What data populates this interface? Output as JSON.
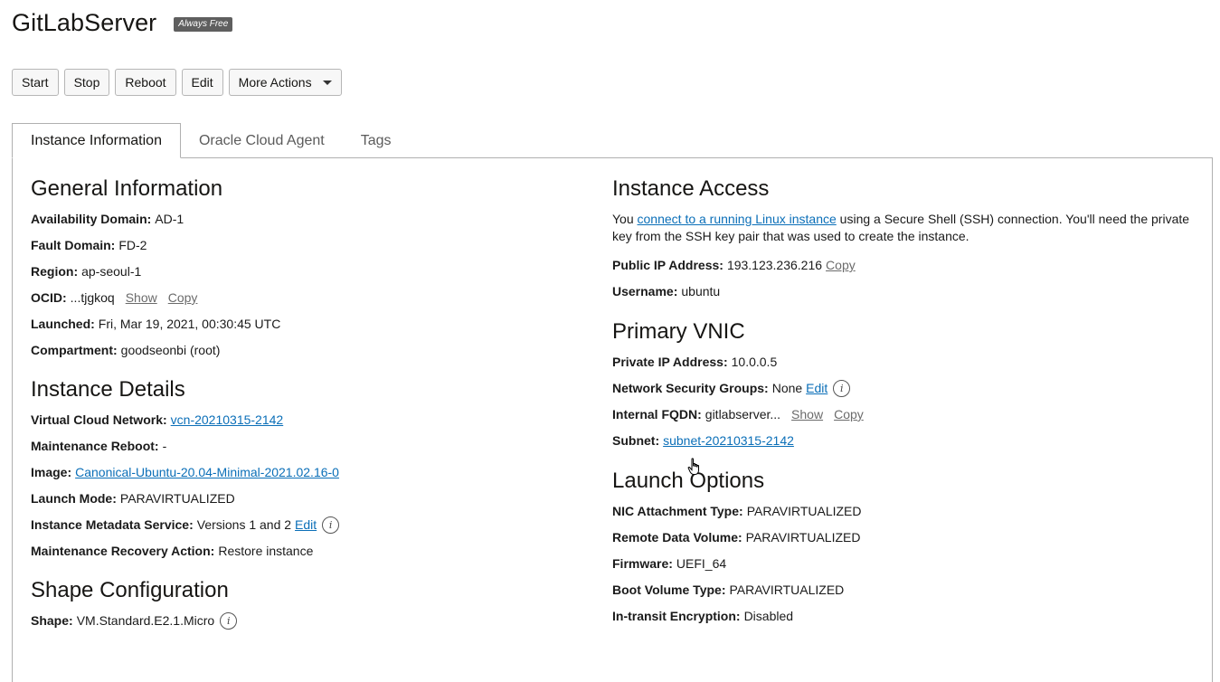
{
  "header": {
    "title": "GitLabServer",
    "badge": "Always Free"
  },
  "toolbar": {
    "start": "Start",
    "stop": "Stop",
    "reboot": "Reboot",
    "edit": "Edit",
    "more_actions": "More Actions"
  },
  "tabs": [
    {
      "label": "Instance Information",
      "active": true
    },
    {
      "label": "Oracle Cloud Agent",
      "active": false
    },
    {
      "label": "Tags",
      "active": false
    }
  ],
  "general": {
    "heading": "General Information",
    "ad_label": "Availability Domain:",
    "ad_value": "AD-1",
    "fd_label": "Fault Domain:",
    "fd_value": "FD-2",
    "region_label": "Region:",
    "region_value": "ap-seoul-1",
    "ocid_label": "OCID:",
    "ocid_value": "...tjgkoq",
    "ocid_show": "Show",
    "ocid_copy": "Copy",
    "launched_label": "Launched:",
    "launched_value": "Fri, Mar 19, 2021, 00:30:45 UTC",
    "compartment_label": "Compartment:",
    "compartment_value": "goodseonbi (root)"
  },
  "details": {
    "heading": "Instance Details",
    "vcn_label": "Virtual Cloud Network:",
    "vcn_value": "vcn-20210315-2142",
    "reboot_label": "Maintenance Reboot:",
    "reboot_value": "-",
    "image_label": "Image:",
    "image_value": "Canonical-Ubuntu-20.04-Minimal-2021.02.16-0",
    "launch_mode_label": "Launch Mode:",
    "launch_mode_value": "PARAVIRTUALIZED",
    "metadata_label": "Instance Metadata Service:",
    "metadata_value": "Versions 1 and 2",
    "metadata_edit": "Edit",
    "recovery_label": "Maintenance Recovery Action:",
    "recovery_value": "Restore instance"
  },
  "shape": {
    "heading": "Shape Configuration",
    "shape_label": "Shape:",
    "shape_value": "VM.Standard.E2.1.Micro"
  },
  "access": {
    "heading": "Instance Access",
    "para_prefix": "You ",
    "para_link": "connect to a running Linux instance",
    "para_suffix": " using a Secure Shell (SSH) connection. You'll need the private key from the SSH key pair that was used to create the instance.",
    "public_ip_label": "Public IP Address:",
    "public_ip_value": "193.123.236.216",
    "public_ip_copy": "Copy",
    "username_label": "Username:",
    "username_value": "ubuntu"
  },
  "vnic": {
    "heading": "Primary VNIC",
    "private_ip_label": "Private IP Address:",
    "private_ip_value": "10.0.0.5",
    "nsg_label": "Network Security Groups:",
    "nsg_value": "None",
    "nsg_edit": "Edit",
    "fqdn_label": "Internal FQDN:",
    "fqdn_value": "gitlabserver...",
    "fqdn_show": "Show",
    "fqdn_copy": "Copy",
    "subnet_label": "Subnet:",
    "subnet_value": "subnet-20210315-2142"
  },
  "launch": {
    "heading": "Launch Options",
    "nic_label": "NIC Attachment Type:",
    "nic_value": "PARAVIRTUALIZED",
    "rdv_label": "Remote Data Volume:",
    "rdv_value": "PARAVIRTUALIZED",
    "firmware_label": "Firmware:",
    "firmware_value": "UEFI_64",
    "boot_label": "Boot Volume Type:",
    "boot_value": "PARAVIRTUALIZED",
    "encryption_label": "In-transit Encryption:",
    "encryption_value": "Disabled"
  },
  "icons": {
    "info": "i"
  }
}
